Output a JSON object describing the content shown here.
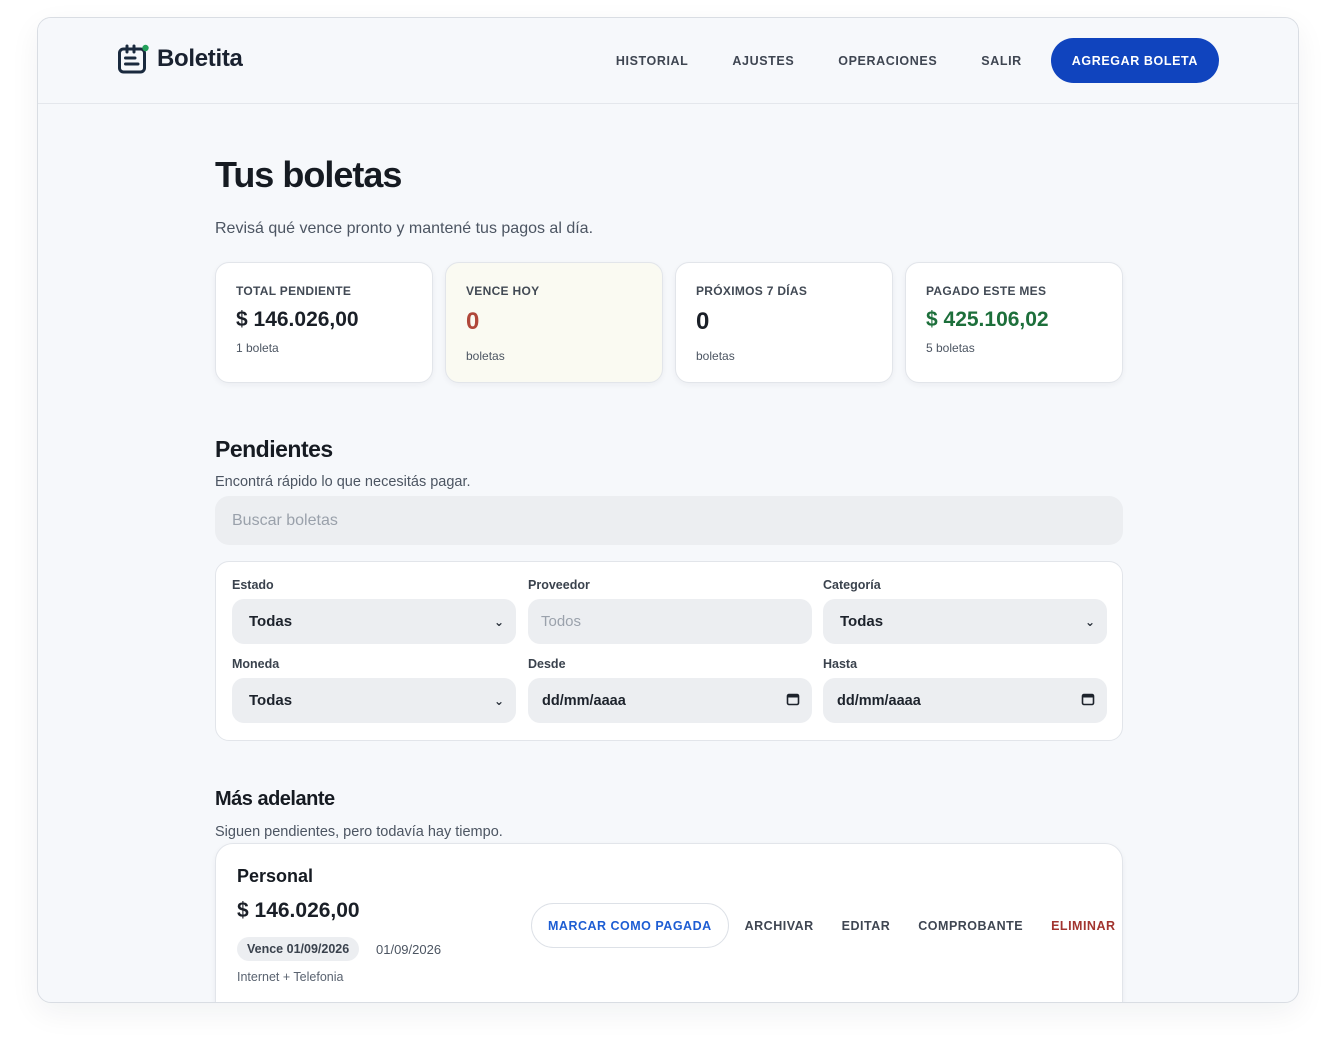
{
  "app": {
    "name": "Boletita",
    "logo_icon": "notepad-icon"
  },
  "nav": {
    "historial": "HISTORIAL",
    "ajustes": "AJUSTES",
    "operaciones": "OPERACIONES",
    "salir": "SALIR",
    "add_button": "AGREGAR BOLETA"
  },
  "header": {
    "title": "Tus boletas",
    "subtitle": "Revisá qué vence pronto y mantené tus pagos al día."
  },
  "stats": [
    {
      "label": "TOTAL PENDIENTE",
      "value": "$ 146.026,00",
      "note": "1 boleta"
    },
    {
      "label": "VENCE HOY",
      "value": "0",
      "note": "boletas"
    },
    {
      "label": "PRÓXIMOS 7 DÍAS",
      "value": "0",
      "note": "boletas"
    },
    {
      "label": "PAGADO ESTE MES",
      "value": "$ 425.106,02",
      "note": "5 boletas"
    }
  ],
  "pendientes": {
    "title": "Pendientes",
    "subtitle": "Encontrá rápido lo que necesitás pagar.",
    "search_placeholder": "Buscar boletas"
  },
  "filters": {
    "estado": {
      "label": "Estado",
      "value": "Todas"
    },
    "proveedor": {
      "label": "Proveedor",
      "placeholder": "Todos"
    },
    "categoria": {
      "label": "Categoría",
      "value": "Todas"
    },
    "moneda": {
      "label": "Moneda",
      "value": "Todas"
    },
    "desde": {
      "label": "Desde",
      "value": "dd/mm/aaaa"
    },
    "hasta": {
      "label": "Hasta",
      "value": "dd/mm/aaaa"
    }
  },
  "mas_adelante": {
    "title": "Más adelante",
    "subtitle": "Siguen pendientes, pero todavía hay tiempo."
  },
  "bill": {
    "title": "Personal",
    "amount": "$ 146.026,00",
    "due_chip": "Vence 01/09/2026",
    "date": "01/09/2026",
    "category": "Internet + Telefonia",
    "actions": {
      "pay": "MARCAR COMO PAGADA",
      "archive": "ARCHIVAR",
      "edit": "EDITAR",
      "receipt": "COMPROBANTE",
      "delete": "ELIMINAR"
    }
  },
  "colors": {
    "primary": "#1044be",
    "pay_text": "#1d5dd3",
    "danger": "#a2342f",
    "today_value": "#b0473a",
    "paid_value": "#1d6f3b"
  }
}
